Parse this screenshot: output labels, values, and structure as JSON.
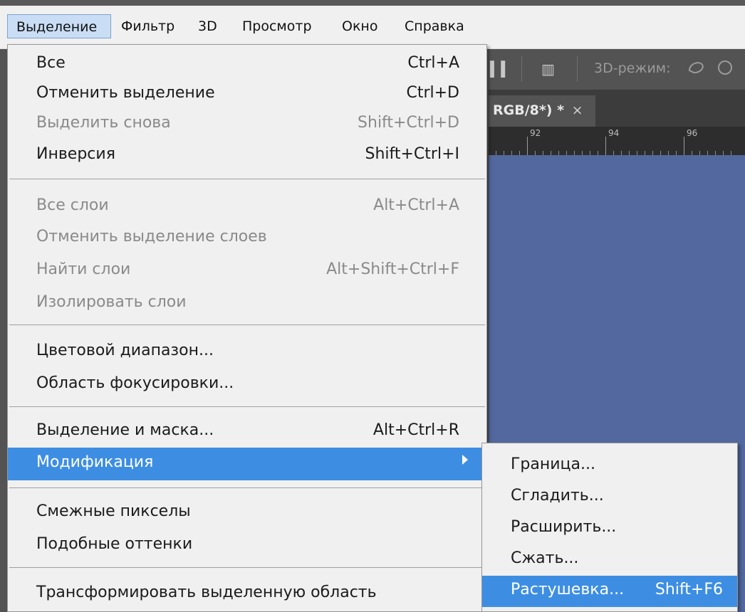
{
  "menubar": {
    "items": [
      {
        "label": "Выделение",
        "active": true
      },
      {
        "label": "Фильтр"
      },
      {
        "label": "3D"
      },
      {
        "label": "Просмотр"
      },
      {
        "label": "Окно"
      },
      {
        "label": "Справка"
      }
    ]
  },
  "options_bar": {
    "mode_label": "3D-режим:"
  },
  "document_tab": {
    "title": "RGB/8*) *",
    "close": "×"
  },
  "ruler": {
    "labels": [
      "92",
      "94",
      "96"
    ]
  },
  "select_menu": {
    "items": [
      {
        "label": "Все",
        "shortcut": "Ctrl+A"
      },
      {
        "label": "Отменить выделение",
        "shortcut": "Ctrl+D"
      },
      {
        "label": "Выделить снова",
        "shortcut": "Shift+Ctrl+D",
        "disabled": true
      },
      {
        "label": "Инверсия",
        "shortcut": "Shift+Ctrl+I"
      },
      {
        "label": "Все слои",
        "shortcut": "Alt+Ctrl+A",
        "disabled": true
      },
      {
        "label": "Отменить выделение слоев",
        "shortcut": "",
        "disabled": true
      },
      {
        "label": "Найти слои",
        "shortcut": "Alt+Shift+Ctrl+F",
        "disabled": true
      },
      {
        "label": "Изолировать слои",
        "shortcut": "",
        "disabled": true
      },
      {
        "label": "Цветовой диапазон...",
        "shortcut": ""
      },
      {
        "label": "Область фокусировки...",
        "shortcut": ""
      },
      {
        "label": "Выделение и маска...",
        "shortcut": "Alt+Ctrl+R"
      },
      {
        "label": "Модификация",
        "shortcut": "",
        "highlighted": true,
        "submenu": true
      },
      {
        "label": "Смежные пикселы",
        "shortcut": ""
      },
      {
        "label": "Подобные оттенки",
        "shortcut": ""
      },
      {
        "label": "Трансформировать выделенную область",
        "shortcut": ""
      }
    ]
  },
  "modify_submenu": {
    "items": [
      {
        "label": "Граница...",
        "shortcut": ""
      },
      {
        "label": "Сгладить...",
        "shortcut": ""
      },
      {
        "label": "Расширить...",
        "shortcut": ""
      },
      {
        "label": "Сжать...",
        "shortcut": ""
      },
      {
        "label": "Растушевка...",
        "shortcut": "Shift+F6",
        "highlighted": true
      }
    ]
  },
  "colors": {
    "highlight": "#3d8ee3",
    "canvas": "#52689e",
    "menu_bg": "#f0f0f0",
    "disabled_text": "#8a8a8a"
  }
}
